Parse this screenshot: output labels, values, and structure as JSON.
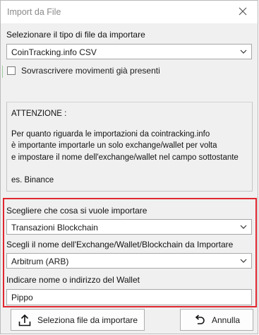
{
  "window": {
    "title": "Import da File"
  },
  "file_type": {
    "label": "Selezionare il tipo di file da importare",
    "selected": "CoinTracking.info CSV"
  },
  "overwrite": {
    "label": "Sovrascrivere movimenti già presenti",
    "checked": false
  },
  "notice": {
    "heading": "ATTENZIONE :",
    "lines": [
      "Per quanto riguarda le importazioni da cointracking.info",
      "è importante importarle un solo exchange/wallet per volta",
      "e impostare il nome dell'exchange/wallet nel campo sottostante"
    ],
    "example": "es. Binance"
  },
  "import_what": {
    "label": "Scegliere che cosa si vuole importare",
    "selected": "Transazioni Blockchain"
  },
  "exchange": {
    "label": "Scegli il nome dell'Exchange/Wallet/Blockchain da Importare",
    "selected": "Arbitrum (ARB)"
  },
  "wallet": {
    "label": "Indicare nome o indirizzo del Wallet",
    "value": "Pippo"
  },
  "buttons": {
    "select_file": "Seleziona file da importare",
    "cancel": "Annulla"
  },
  "colors": {
    "highlight": "#e0262e",
    "window_bg": "#f0f0f0"
  }
}
